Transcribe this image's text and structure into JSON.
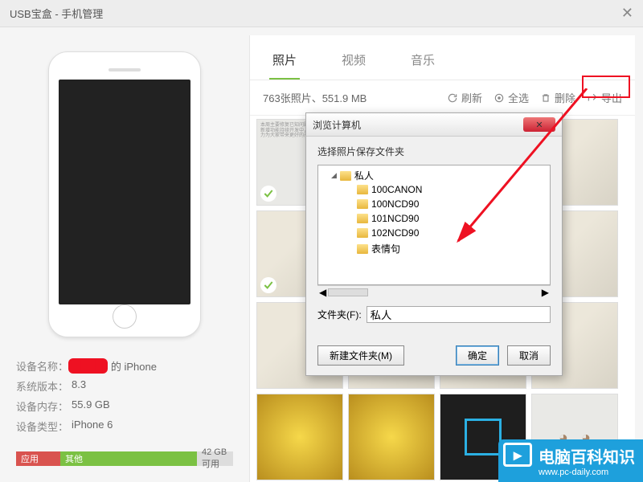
{
  "window": {
    "title": "USB宝盒 - 手机管理"
  },
  "device": {
    "name_label": "设备名称：",
    "name_redacted": "████",
    "name_suffix": "的 iPhone",
    "os_label": "系统版本：",
    "os_value": "8.3",
    "mem_label": "设备内存：",
    "mem_value": "55.9 GB",
    "type_label": "设备类型：",
    "type_value": "iPhone 6"
  },
  "storage": {
    "app_label": "应用",
    "other_label": "其他",
    "free_label": "42 GB 可用"
  },
  "tabs": {
    "photo": "照片",
    "video": "视频",
    "music": "音乐"
  },
  "toolbar": {
    "count": "763张照片、551.9 MB",
    "refresh": "刷新",
    "select_all": "全选",
    "delete": "删除",
    "export": "导出"
  },
  "dialog": {
    "title": "浏览计算机",
    "subtitle": "选择照片保存文件夹",
    "root": "私人",
    "items": [
      "100CANON",
      "100NCD90",
      "101NCD90",
      "102NCD90",
      "表情句"
    ],
    "folder_label": "文件夹(F):",
    "folder_value": "私人",
    "new_folder": "新建文件夹(M)",
    "ok": "确定",
    "cancel": "取消"
  },
  "watermark": {
    "brand": "电脑百科知识",
    "url": "www.pc-daily.com"
  }
}
